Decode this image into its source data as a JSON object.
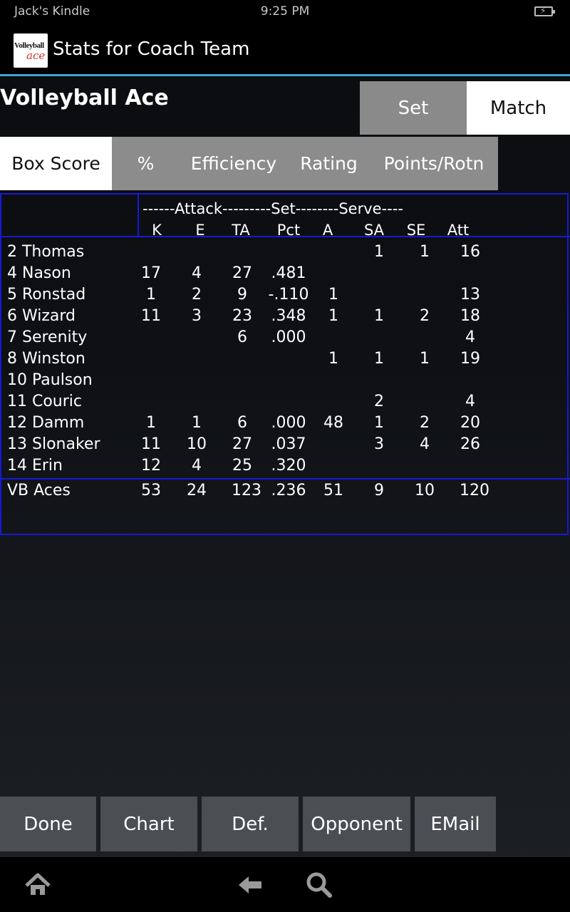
{
  "status_bar": {
    "device": "Jack's Kindle",
    "time": "9:25 PM"
  },
  "action_bar": {
    "logo_text_1": "Volleyball",
    "logo_text_2": "ace",
    "title": "Stats for Coach Team"
  },
  "heading": "Volleyball Ace",
  "toggle": {
    "set": "Set",
    "match": "Match",
    "selected": "Match"
  },
  "tabs": [
    {
      "label": "Box Score",
      "selected": true
    },
    {
      "label": "%"
    },
    {
      "label": "Efficiency"
    },
    {
      "label": "Rating"
    },
    {
      "label": "Points/Rotn"
    }
  ],
  "table": {
    "group_header": "------Attack---------Set--------Serve----",
    "columns": [
      "K",
      "E",
      "TA",
      "Pct",
      "A",
      "SA",
      "SE",
      "Att"
    ],
    "rows": [
      {
        "name": "2 Thomas",
        "cells": [
          "",
          "",
          "",
          "",
          "",
          "1",
          "1",
          "16"
        ]
      },
      {
        "name": "4 Nason",
        "cells": [
          "17",
          "4",
          "27",
          ".481",
          "",
          "",
          "",
          ""
        ]
      },
      {
        "name": "5 Ronstad",
        "cells": [
          "1",
          "2",
          "9",
          "-.110",
          "1",
          "",
          "",
          "13"
        ]
      },
      {
        "name": "6 Wizard",
        "cells": [
          "11",
          "3",
          "23",
          ".348",
          "1",
          "1",
          "2",
          "18"
        ]
      },
      {
        "name": "7 Serenity",
        "cells": [
          "",
          "",
          "6",
          ".000",
          "",
          "",
          "",
          "4"
        ]
      },
      {
        "name": "8 Winston",
        "cells": [
          "",
          "",
          "",
          "",
          "1",
          "1",
          "1",
          "19"
        ]
      },
      {
        "name": "10 Paulson",
        "cells": [
          "",
          "",
          "",
          "",
          "",
          "",
          "",
          ""
        ]
      },
      {
        "name": "11 Couric",
        "cells": [
          "",
          "",
          "",
          "",
          "",
          "2",
          "",
          "4"
        ]
      },
      {
        "name": "12 Damm",
        "cells": [
          "1",
          "1",
          "6",
          ".000",
          "48",
          "1",
          "2",
          "20"
        ]
      },
      {
        "name": "13 Slonaker",
        "cells": [
          "11",
          "10",
          "27",
          ".037",
          "",
          "3",
          "4",
          "26"
        ]
      },
      {
        "name": "14 Erin",
        "cells": [
          "12",
          "4",
          "25",
          ".320",
          "",
          "",
          "",
          ""
        ]
      }
    ],
    "total": {
      "name": "VB Aces",
      "cells": [
        "53",
        "24",
        "123",
        ".236",
        "51",
        "9",
        "10",
        "120"
      ]
    }
  },
  "bottom_buttons": {
    "done": "Done",
    "chart": "Chart",
    "def": "Def.",
    "opponent": "Opponent",
    "email": "EMail"
  },
  "nav": {
    "home": "home-icon",
    "back": "back-arrow-icon",
    "search": "search-icon"
  },
  "colors": {
    "accent_line": "#3ba6d8",
    "table_border": "#1818d6",
    "tab_gray": "#8c8c8c",
    "button_gray": "#4b4e53"
  }
}
